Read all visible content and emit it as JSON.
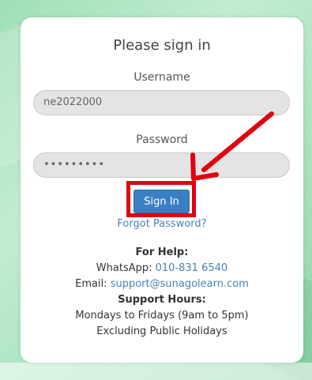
{
  "login": {
    "title": "Please sign in",
    "username_label": "Username",
    "username_value": "ne2022000",
    "password_label": "Password",
    "password_value": "•••••••••",
    "signin_label": "Sign In",
    "forgot_label": "Forgot Password?"
  },
  "help": {
    "heading": "For Help:",
    "whatsapp_prefix": "WhatsApp: ",
    "whatsapp_number": "010-831 6540",
    "email_prefix": "Email: ",
    "email_address": "support@sunagolearn.com",
    "hours_heading": "Support Hours:",
    "hours_line1": "Mondays to Fridays (9am to 5pm)",
    "hours_line2": "Excluding Public Holidays"
  },
  "colors": {
    "highlight": "#e3000f",
    "button": "#3a7fc3",
    "link": "#4a7fb7"
  },
  "icons": {
    "annotation": "red-arrow-icon"
  }
}
